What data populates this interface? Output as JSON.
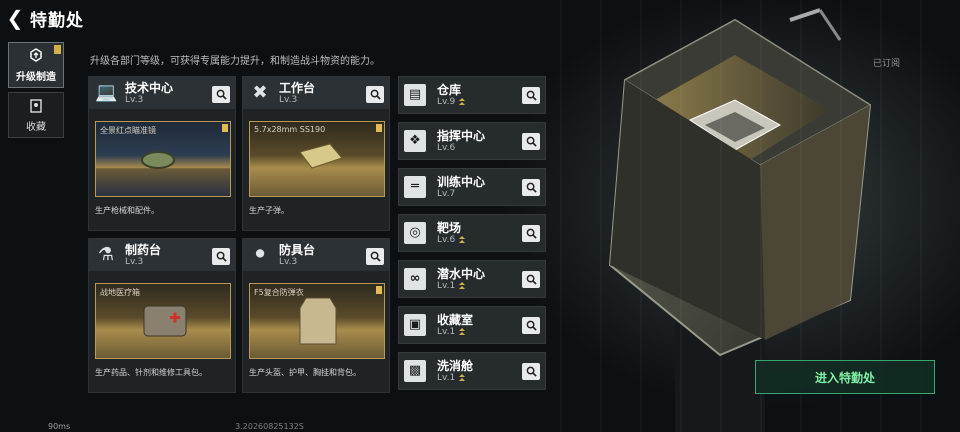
{
  "header": {
    "title": "特勤处",
    "subtitle": "升级各部门等级，可获得专属能力提升，和制造战斗物资的能力。",
    "subscribed": "已订阅"
  },
  "sidenav": [
    {
      "label": "升级制造",
      "icon": "upgrade-icon",
      "active": true
    },
    {
      "label": "收藏",
      "icon": "collection-icon",
      "active": false
    }
  ],
  "big_cards": [
    {
      "name": "技术中心",
      "level": "Lv.3",
      "icon": "computer-icon",
      "product": "全景红点瞄准镜",
      "desc": "生产枪械和配件。"
    },
    {
      "name": "工作台",
      "level": "Lv.3",
      "icon": "tools-icon",
      "product": "5.7x28mm SS190",
      "desc": "生产子弹。"
    },
    {
      "name": "制药台",
      "level": "Lv.3",
      "icon": "microscope-icon",
      "product": "战地医疗箱",
      "desc": "生产药品、针剂和维修工具包。"
    },
    {
      "name": "防具台",
      "level": "Lv.3",
      "icon": "armor-parts-icon",
      "product": "F5复合防弹衣",
      "desc": "生产头盔、护甲、胸挂和背包。"
    }
  ],
  "small_cards": [
    {
      "name": "仓库",
      "level": "Lv.9",
      "icon": "warehouse-icon",
      "upgradable": true
    },
    {
      "name": "指挥中心",
      "level": "Lv.6",
      "icon": "chip-icon",
      "upgradable": false
    },
    {
      "name": "训练中心",
      "level": "Lv.7",
      "icon": "dumbbell-icon",
      "upgradable": false
    },
    {
      "name": "靶场",
      "level": "Lv.6",
      "icon": "target-icon",
      "upgradable": true
    },
    {
      "name": "潜水中心",
      "level": "Lv.1",
      "icon": "goggles-icon",
      "upgradable": true
    },
    {
      "name": "收藏室",
      "level": "Lv.1",
      "icon": "display-case-icon",
      "upgradable": true
    },
    {
      "name": "洗消舱",
      "level": "Lv.1",
      "icon": "decon-icon",
      "upgradable": true
    }
  ],
  "cta": {
    "label": "进入特勤处"
  },
  "footer": {
    "ping": "90ms",
    "version": "3.20260825132S"
  }
}
